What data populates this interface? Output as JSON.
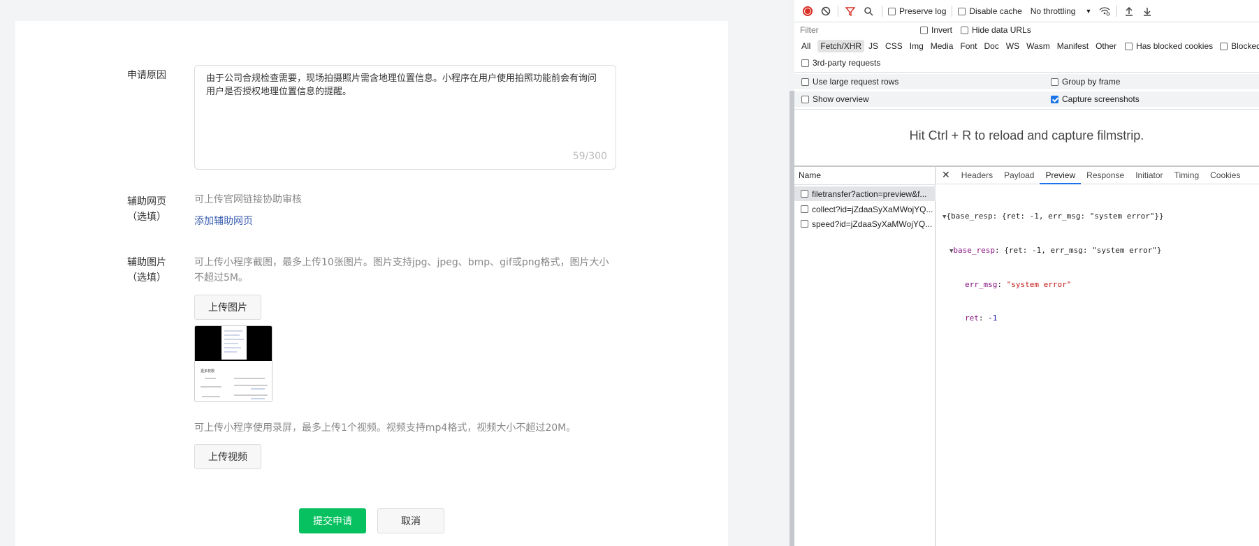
{
  "form": {
    "reason_label": "申请原因",
    "reason_text": "由于公司合规检查需要，现场拍摄照片需含地理位置信息。小程序在用户使用拍照功能前会有询问用户是否授权地理位置信息的提醒。",
    "reason_count": "59/300",
    "webpage_label_line1": "辅助网页",
    "webpage_label_line2": "（选填）",
    "webpage_desc": "可上传官网链接协助审核",
    "add_webpage_link": "添加辅助网页",
    "image_label_line1": "辅助图片",
    "image_label_line2": "（选填）",
    "image_desc": "可上传小程序截图，最多上传10张图片。图片支持jpg、jpeg、bmp、gif或png格式，图片大小不超过5M。",
    "upload_image_button": "上传图片",
    "video_desc": "可上传小程序使用录屏，最多上传1个视频。视频支持mp4格式，视频大小不超过20M。",
    "upload_video_button": "上传视频",
    "submit_button": "提交申请",
    "cancel_button": "取消"
  },
  "thumbnail": {
    "title": "更多权限"
  },
  "devtools": {
    "toolbar": {
      "preserve_log": "Preserve log",
      "disable_cache": "Disable cache",
      "throttling": "No throttling"
    },
    "filter_placeholder": "Filter",
    "invert": "Invert",
    "hide_data_urls": "Hide data URLs",
    "types": [
      "All",
      "Fetch/XHR",
      "JS",
      "CSS",
      "Img",
      "Media",
      "Font",
      "Doc",
      "WS",
      "Wasm",
      "Manifest",
      "Other"
    ],
    "has_blocked_cookies": "Has blocked cookies",
    "blocked_requests": "Blocked R",
    "third_party": "3rd-party requests",
    "large_rows": "Use large request rows",
    "group_by_frame": "Group by frame",
    "show_overview": "Show overview",
    "capture_screenshots": "Capture screenshots",
    "filmstrip_hint": "Hit Ctrl + R to reload and capture filmstrip.",
    "name_header": "Name",
    "requests": [
      "filetransfer?action=preview&f...",
      "collect?id=jZdaaSyXaMWojYQ...",
      "speed?id=jZdaaSyXaMWojYQ..."
    ],
    "tabs": [
      "Headers",
      "Payload",
      "Preview",
      "Response",
      "Initiator",
      "Timing",
      "Cookies"
    ],
    "active_tab": "Preview",
    "preview": {
      "root_key": "{base_resp: {ret: -1, err_msg: \"system error\"}}",
      "child_key": "base_resp",
      "child_summary": "{ret: -1, err_msg: \"system error\"}",
      "err_msg_key": "err_msg",
      "err_msg_val": "\"system error\"",
      "ret_key": "ret",
      "ret_val": "-1"
    }
  },
  "colors": {
    "primary_green": "#07c160",
    "link_blue": "#3a5eb0",
    "devtools_accent": "#1a73e8"
  }
}
